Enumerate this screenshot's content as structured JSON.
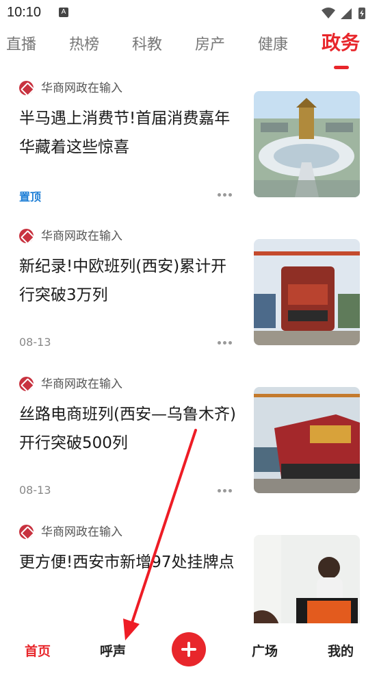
{
  "status_bar": {
    "time": "10:10",
    "notification_glyph": "A"
  },
  "tabs": [
    {
      "label": "直播",
      "active": false
    },
    {
      "label": "热榜",
      "active": false
    },
    {
      "label": "科教",
      "active": false
    },
    {
      "label": "房产",
      "active": false
    },
    {
      "label": "健康",
      "active": false
    },
    {
      "label": "政务",
      "active": true
    }
  ],
  "feed": [
    {
      "source": "华商网政在输入",
      "title": "半马遇上消费节!首届消费嘉年华藏着这些惊喜",
      "meta": "置顶",
      "pinned": true
    },
    {
      "source": "华商网政在输入",
      "title": "新纪录!中欧班列(西安)累计开行突破3万列",
      "meta": "08-13",
      "pinned": false
    },
    {
      "source": "华商网政在输入",
      "title": "丝路电商班列(西安—乌鲁木齐)开行突破500列",
      "meta": "08-13",
      "pinned": false
    },
    {
      "source": "华商网政在输入",
      "title": "更方便!西安市新增97处挂牌点",
      "meta": "",
      "pinned": false
    }
  ],
  "bottom_nav": {
    "home": "首页",
    "voice": "呼声",
    "plaza": "广场",
    "mine": "我的"
  },
  "colors": {
    "accent": "#e8262b",
    "pinned": "#1f7fd6"
  },
  "icons": [
    "wifi-icon",
    "signal-icon",
    "battery-charging-icon",
    "plus-icon",
    "more-icon",
    "source-logo-icon"
  ]
}
